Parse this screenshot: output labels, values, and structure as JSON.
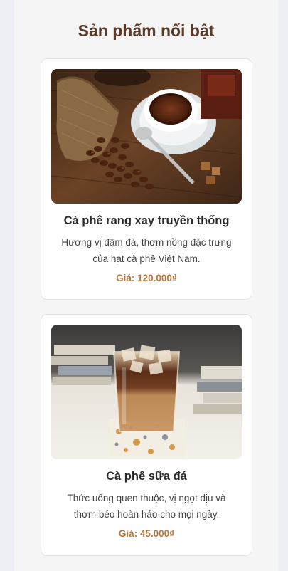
{
  "section": {
    "title": "Sản phẩm nổi bật"
  },
  "products": [
    {
      "name": "Cà phê rang xay truyền thống",
      "description": "Hương vị đậm đà, thơm nồng đặc trưng của hạt cà phê Việt Nam.",
      "price": "Giá: 120.000₫",
      "image_icon": "hot-coffee-beans-photo"
    },
    {
      "name": "Cà phê sữa đá",
      "description": "Thức uống quen thuộc, vị ngọt dịu và thơm béo hoàn hảo cho mọi ngày.",
      "price": "Giá: 45.000₫",
      "image_icon": "iced-milk-coffee-photo"
    }
  ],
  "colors": {
    "title": "#5a3a29",
    "price": "#b8773a",
    "card_bg": "#ffffff",
    "page_bg": "#f5f5f5"
  }
}
